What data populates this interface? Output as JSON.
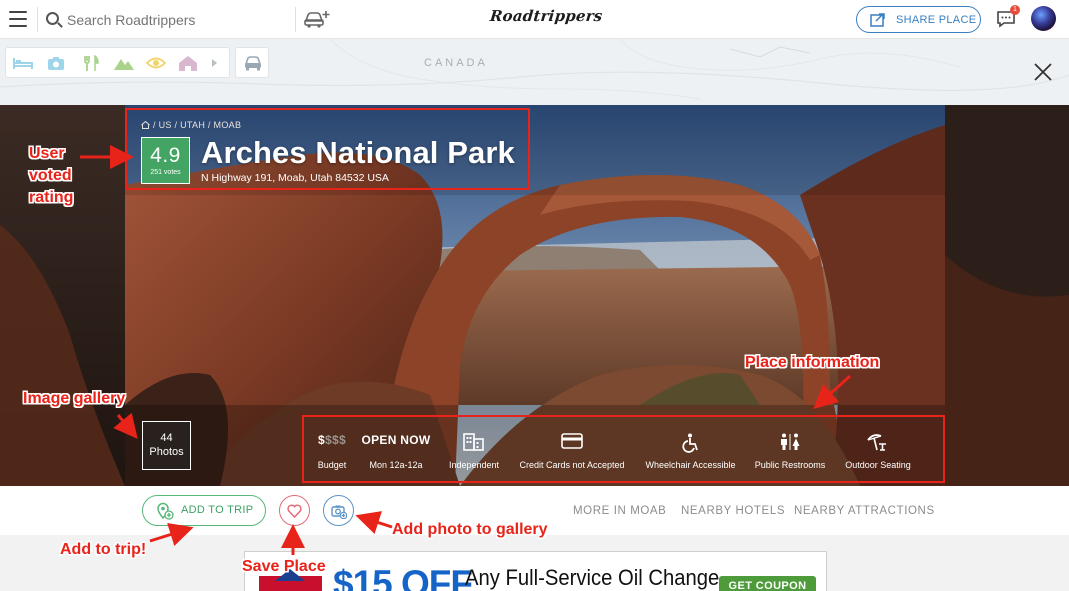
{
  "header": {
    "search_placeholder": "Search Roadtrippers",
    "logo_text": "Roadtrippers",
    "share_label": "SHARE PLACE",
    "notification_count": "1"
  },
  "map": {
    "label": "CANADA"
  },
  "place": {
    "breadcrumb": "/ US / UTAH / MOAB",
    "rating": "4.9",
    "votes": "251 votes",
    "name": "Arches National Park",
    "address": "N Highway 191, Moab, Utah 84532 USA",
    "photos_count": "44",
    "photos_label": "Photos"
  },
  "info": {
    "budget_symbol_active": "$",
    "budget_symbol_inactive": "$$$",
    "budget_label": "Budget",
    "open_status": "OPEN NOW",
    "hours": "Mon 12a-12a",
    "independent_label": "Independent",
    "cards_label": "Credit Cards not Accepted",
    "wheelchair_label": "Wheelchair Accessible",
    "restrooms_label": "Public Restrooms",
    "seating_label": "Outdoor Seating"
  },
  "actions": {
    "add_to_trip": "ADD TO TRIP",
    "links": [
      "MORE IN MOAB",
      "NEARBY HOTELS",
      "NEARBY ATTRACTIONS"
    ]
  },
  "ad": {
    "price": "$15 OFF",
    "headline": "Any Full-Service Oil Change",
    "cta": "GET COUPON"
  },
  "annotations": {
    "rating": "User\nvoted\nrating",
    "gallery": "Image gallery",
    "place_info": "Place information",
    "add_trip": "Add to trip!",
    "save_place": "Save Place",
    "add_photo": "Add photo to gallery"
  },
  "colors": {
    "rating_green": "#43a463",
    "share_blue": "#3a7fc1",
    "annotation_red": "#e8231a",
    "trip_green": "#58b77a",
    "save_pink": "#e46b78"
  }
}
